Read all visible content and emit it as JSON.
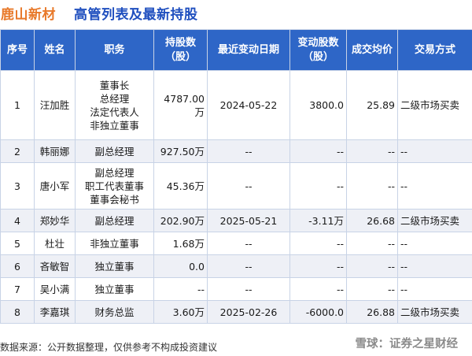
{
  "header": {
    "company": "鹿山新材",
    "title": "高管列表及最新持股"
  },
  "columns": [
    "序号",
    "姓名",
    "职务",
    "持股数\n（股）",
    "最近变动日期",
    "变动股数\n（股）",
    "成交均价",
    "交易方式"
  ],
  "rows": [
    {
      "no": "1",
      "name": "汪加胜",
      "positions": [
        "董事长",
        "总经理",
        "法定代表人",
        "非独立董事"
      ],
      "shares": "4787.00万",
      "date": "2024-05-22",
      "change": "3800.0",
      "change_color": "red",
      "price": "25.89",
      "price_color": "red",
      "method": "二级市场买卖"
    },
    {
      "no": "2",
      "name": "韩丽娜",
      "positions": [
        "副总经理"
      ],
      "shares": "927.50万",
      "date": "--",
      "change": "--",
      "change_color": "",
      "price": "--",
      "price_color": "",
      "method": "--"
    },
    {
      "no": "3",
      "name": "唐小军",
      "positions": [
        "副总经理",
        "职工代表董事",
        "董事会秘书"
      ],
      "shares": "45.36万",
      "date": "--",
      "change": "--",
      "change_color": "",
      "price": "--",
      "price_color": "",
      "method": "--"
    },
    {
      "no": "4",
      "name": "郑妙华",
      "positions": [
        "副总经理"
      ],
      "shares": "202.90万",
      "date": "2025-05-21",
      "change": "-3.11万",
      "change_color": "green",
      "price": "26.68",
      "price_color": "green",
      "method": "二级市场买卖"
    },
    {
      "no": "5",
      "name": "杜壮",
      "positions": [
        "非独立董事"
      ],
      "shares": "1.68万",
      "date": "--",
      "change": "--",
      "change_color": "",
      "price": "--",
      "price_color": "",
      "method": "--"
    },
    {
      "no": "6",
      "name": "吝敏智",
      "positions": [
        "独立董事"
      ],
      "shares": "0.0",
      "date": "--",
      "change": "--",
      "change_color": "",
      "price": "--",
      "price_color": "",
      "method": "--"
    },
    {
      "no": "7",
      "name": "吴小满",
      "positions": [
        "独立董事"
      ],
      "shares": "--",
      "date": "--",
      "change": "--",
      "change_color": "",
      "price": "--",
      "price_color": "",
      "method": "--"
    },
    {
      "no": "8",
      "name": "李嘉琪",
      "positions": [
        "财务总监"
      ],
      "shares": "3.60万",
      "date": "2025-02-26",
      "change": "-6000.0",
      "change_color": "green",
      "price": "26.88",
      "price_color": "green",
      "method": "二级市场买卖"
    }
  ],
  "footer": {
    "source": "数据来源：公开数据整理，仅供参考不构成投资建议"
  },
  "watermark": {
    "brand": "雪球：证券之星财经"
  }
}
